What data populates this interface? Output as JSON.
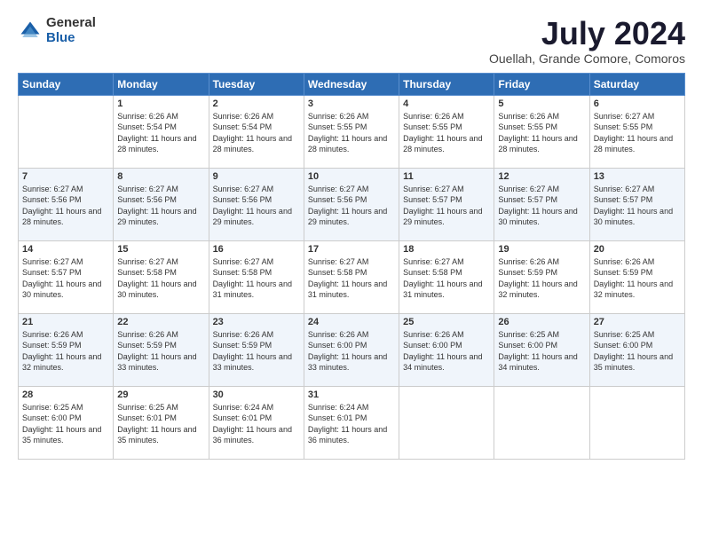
{
  "logo": {
    "general": "General",
    "blue": "Blue"
  },
  "title": "July 2024",
  "location": "Ouellah, Grande Comore, Comoros",
  "header_days": [
    "Sunday",
    "Monday",
    "Tuesday",
    "Wednesday",
    "Thursday",
    "Friday",
    "Saturday"
  ],
  "weeks": [
    [
      {
        "day": "",
        "sunrise": "",
        "sunset": "",
        "daylight": ""
      },
      {
        "day": "1",
        "sunrise": "Sunrise: 6:26 AM",
        "sunset": "Sunset: 5:54 PM",
        "daylight": "Daylight: 11 hours and 28 minutes."
      },
      {
        "day": "2",
        "sunrise": "Sunrise: 6:26 AM",
        "sunset": "Sunset: 5:54 PM",
        "daylight": "Daylight: 11 hours and 28 minutes."
      },
      {
        "day": "3",
        "sunrise": "Sunrise: 6:26 AM",
        "sunset": "Sunset: 5:55 PM",
        "daylight": "Daylight: 11 hours and 28 minutes."
      },
      {
        "day": "4",
        "sunrise": "Sunrise: 6:26 AM",
        "sunset": "Sunset: 5:55 PM",
        "daylight": "Daylight: 11 hours and 28 minutes."
      },
      {
        "day": "5",
        "sunrise": "Sunrise: 6:26 AM",
        "sunset": "Sunset: 5:55 PM",
        "daylight": "Daylight: 11 hours and 28 minutes."
      },
      {
        "day": "6",
        "sunrise": "Sunrise: 6:27 AM",
        "sunset": "Sunset: 5:55 PM",
        "daylight": "Daylight: 11 hours and 28 minutes."
      }
    ],
    [
      {
        "day": "7",
        "sunrise": "Sunrise: 6:27 AM",
        "sunset": "Sunset: 5:56 PM",
        "daylight": "Daylight: 11 hours and 28 minutes."
      },
      {
        "day": "8",
        "sunrise": "Sunrise: 6:27 AM",
        "sunset": "Sunset: 5:56 PM",
        "daylight": "Daylight: 11 hours and 29 minutes."
      },
      {
        "day": "9",
        "sunrise": "Sunrise: 6:27 AM",
        "sunset": "Sunset: 5:56 PM",
        "daylight": "Daylight: 11 hours and 29 minutes."
      },
      {
        "day": "10",
        "sunrise": "Sunrise: 6:27 AM",
        "sunset": "Sunset: 5:56 PM",
        "daylight": "Daylight: 11 hours and 29 minutes."
      },
      {
        "day": "11",
        "sunrise": "Sunrise: 6:27 AM",
        "sunset": "Sunset: 5:57 PM",
        "daylight": "Daylight: 11 hours and 29 minutes."
      },
      {
        "day": "12",
        "sunrise": "Sunrise: 6:27 AM",
        "sunset": "Sunset: 5:57 PM",
        "daylight": "Daylight: 11 hours and 30 minutes."
      },
      {
        "day": "13",
        "sunrise": "Sunrise: 6:27 AM",
        "sunset": "Sunset: 5:57 PM",
        "daylight": "Daylight: 11 hours and 30 minutes."
      }
    ],
    [
      {
        "day": "14",
        "sunrise": "Sunrise: 6:27 AM",
        "sunset": "Sunset: 5:57 PM",
        "daylight": "Daylight: 11 hours and 30 minutes."
      },
      {
        "day": "15",
        "sunrise": "Sunrise: 6:27 AM",
        "sunset": "Sunset: 5:58 PM",
        "daylight": "Daylight: 11 hours and 30 minutes."
      },
      {
        "day": "16",
        "sunrise": "Sunrise: 6:27 AM",
        "sunset": "Sunset: 5:58 PM",
        "daylight": "Daylight: 11 hours and 31 minutes."
      },
      {
        "day": "17",
        "sunrise": "Sunrise: 6:27 AM",
        "sunset": "Sunset: 5:58 PM",
        "daylight": "Daylight: 11 hours and 31 minutes."
      },
      {
        "day": "18",
        "sunrise": "Sunrise: 6:27 AM",
        "sunset": "Sunset: 5:58 PM",
        "daylight": "Daylight: 11 hours and 31 minutes."
      },
      {
        "day": "19",
        "sunrise": "Sunrise: 6:26 AM",
        "sunset": "Sunset: 5:59 PM",
        "daylight": "Daylight: 11 hours and 32 minutes."
      },
      {
        "day": "20",
        "sunrise": "Sunrise: 6:26 AM",
        "sunset": "Sunset: 5:59 PM",
        "daylight": "Daylight: 11 hours and 32 minutes."
      }
    ],
    [
      {
        "day": "21",
        "sunrise": "Sunrise: 6:26 AM",
        "sunset": "Sunset: 5:59 PM",
        "daylight": "Daylight: 11 hours and 32 minutes."
      },
      {
        "day": "22",
        "sunrise": "Sunrise: 6:26 AM",
        "sunset": "Sunset: 5:59 PM",
        "daylight": "Daylight: 11 hours and 33 minutes."
      },
      {
        "day": "23",
        "sunrise": "Sunrise: 6:26 AM",
        "sunset": "Sunset: 5:59 PM",
        "daylight": "Daylight: 11 hours and 33 minutes."
      },
      {
        "day": "24",
        "sunrise": "Sunrise: 6:26 AM",
        "sunset": "Sunset: 6:00 PM",
        "daylight": "Daylight: 11 hours and 33 minutes."
      },
      {
        "day": "25",
        "sunrise": "Sunrise: 6:26 AM",
        "sunset": "Sunset: 6:00 PM",
        "daylight": "Daylight: 11 hours and 34 minutes."
      },
      {
        "day": "26",
        "sunrise": "Sunrise: 6:25 AM",
        "sunset": "Sunset: 6:00 PM",
        "daylight": "Daylight: 11 hours and 34 minutes."
      },
      {
        "day": "27",
        "sunrise": "Sunrise: 6:25 AM",
        "sunset": "Sunset: 6:00 PM",
        "daylight": "Daylight: 11 hours and 35 minutes."
      }
    ],
    [
      {
        "day": "28",
        "sunrise": "Sunrise: 6:25 AM",
        "sunset": "Sunset: 6:00 PM",
        "daylight": "Daylight: 11 hours and 35 minutes."
      },
      {
        "day": "29",
        "sunrise": "Sunrise: 6:25 AM",
        "sunset": "Sunset: 6:01 PM",
        "daylight": "Daylight: 11 hours and 35 minutes."
      },
      {
        "day": "30",
        "sunrise": "Sunrise: 6:24 AM",
        "sunset": "Sunset: 6:01 PM",
        "daylight": "Daylight: 11 hours and 36 minutes."
      },
      {
        "day": "31",
        "sunrise": "Sunrise: 6:24 AM",
        "sunset": "Sunset: 6:01 PM",
        "daylight": "Daylight: 11 hours and 36 minutes."
      },
      {
        "day": "",
        "sunrise": "",
        "sunset": "",
        "daylight": ""
      },
      {
        "day": "",
        "sunrise": "",
        "sunset": "",
        "daylight": ""
      },
      {
        "day": "",
        "sunrise": "",
        "sunset": "",
        "daylight": ""
      }
    ]
  ]
}
